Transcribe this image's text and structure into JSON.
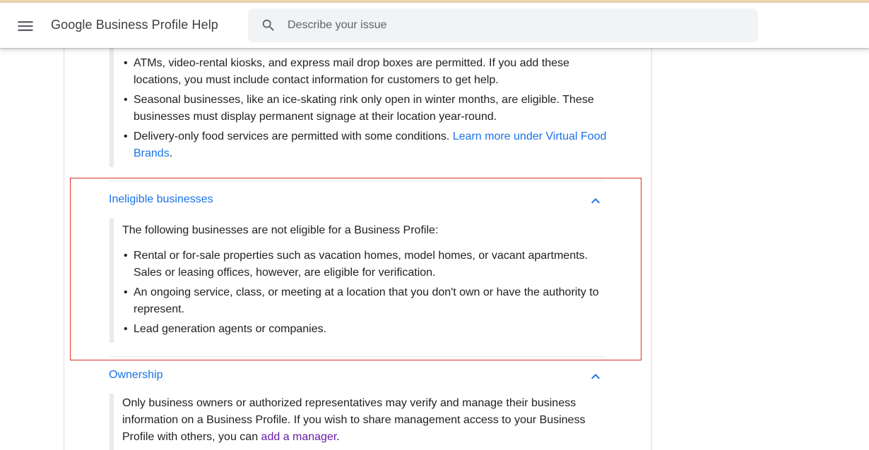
{
  "colors": {
    "link": "#1a73e8",
    "visited_link": "#681da8",
    "highlight_border": "#d93025",
    "top_accent": "#f5d9b5"
  },
  "header": {
    "menu_icon": "hamburger-menu-icon",
    "title": "Google Business Profile Help",
    "search": {
      "icon": "search-icon",
      "placeholder": "Describe your issue",
      "value": ""
    }
  },
  "eligible_section": {
    "bullets": [
      {
        "text": "ATMs, video-rental kiosks, and express mail drop boxes are permitted. If you add these locations, you must include contact information for customers to get help."
      },
      {
        "text": "Seasonal businesses, like an ice-skating rink only open in winter months, are eligible. These businesses must display permanent signage at their location year-round."
      },
      {
        "text": "Delivery-only food services are permitted with some conditions. ",
        "link": "Learn more under Virtual Food Brands",
        "trailing": "."
      }
    ]
  },
  "ineligible_section": {
    "title": "Ineligible businesses",
    "chevron_icon": "chevron-up-icon",
    "intro": "The following businesses are not eligible for a Business Profile:",
    "bullets": [
      "Rental or for-sale properties such as vacation homes, model homes, or vacant apartments. Sales or leasing offices, however, are eligible for verification.",
      "An ongoing service, class, or meeting at a location that you don't own or have the authority to represent.",
      "Lead generation agents or companies."
    ]
  },
  "ownership_section": {
    "title": "Ownership",
    "chevron_icon": "chevron-up-icon",
    "text_before_link": "Only business owners or authorized representatives may verify and manage their business information on a Business Profile. If you wish to share management access to your Business Profile with others, you can ",
    "link": "add a manager",
    "text_after_link": "."
  }
}
